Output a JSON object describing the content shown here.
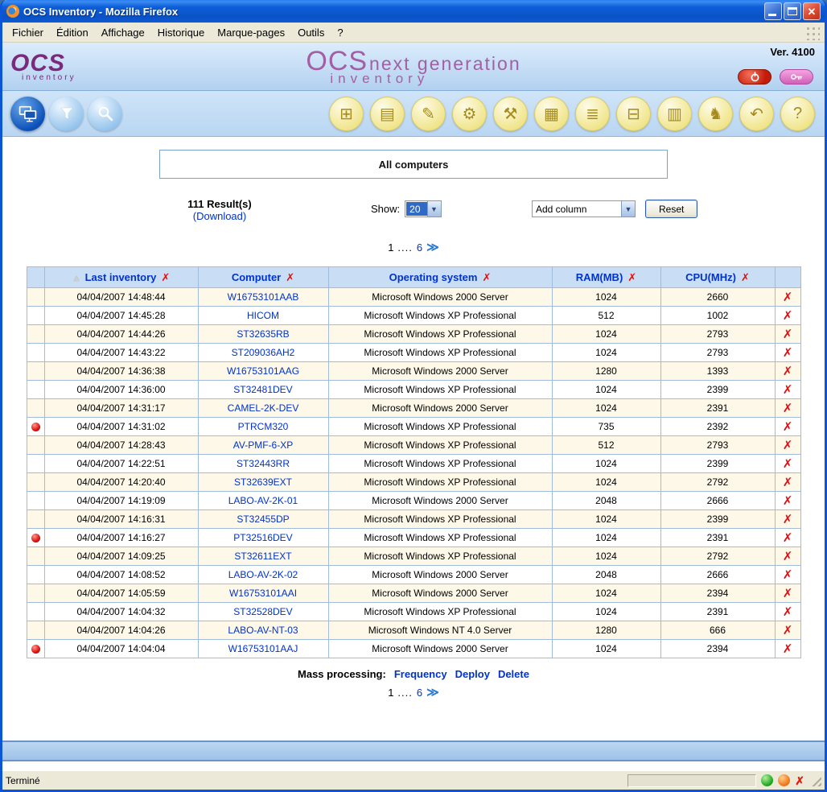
{
  "colors": {
    "accent_blue": "#0033cc",
    "alert_red": "#cc0000",
    "brand_purple": "#9b3d9b",
    "row_alt": "#fdf8e7"
  },
  "window": {
    "title": "OCS Inventory - Mozilla Firefox",
    "menu_items": [
      "Fichier",
      "Édition",
      "Affichage",
      "Historique",
      "Marque-pages",
      "Outils",
      "?"
    ]
  },
  "header": {
    "logo_main": "OCS",
    "logo_sub": "inventory",
    "brand_line1_big": "OCS",
    "brand_line1_rest": "next generation",
    "brand_line2": "inventory",
    "version": "Ver. 4100"
  },
  "toolbar": {
    "left_icons": [
      "all-computers-icon",
      "filter-icon",
      "search-icon"
    ],
    "right_icons": [
      {
        "name": "gift-icon",
        "glyph": "⊞"
      },
      {
        "name": "firewall-icon",
        "glyph": "▤"
      },
      {
        "name": "tag-edit-icon",
        "glyph": "✎"
      },
      {
        "name": "settings-icon",
        "glyph": "⚙"
      },
      {
        "name": "wrench-icon",
        "glyph": "⚒"
      },
      {
        "name": "packages-icon",
        "glyph": "▦"
      },
      {
        "name": "documents-icon",
        "glyph": "≣"
      },
      {
        "name": "duplicates-icon",
        "glyph": "⊟"
      },
      {
        "name": "report-icon",
        "glyph": "▥"
      },
      {
        "name": "agent-icon",
        "glyph": "♞"
      },
      {
        "name": "restore-icon",
        "glyph": "↶"
      },
      {
        "name": "help-icon",
        "glyph": "?"
      }
    ]
  },
  "content": {
    "page_title": "All computers",
    "results_count": "111 Result(s)",
    "download_label": "(Download)",
    "show_label": "Show:",
    "show_value": "20",
    "add_column_value": "Add column",
    "reset_label": "Reset",
    "pagination": {
      "current": "1",
      "dots": "....",
      "last_page": "6"
    },
    "mass_processing_label": "Mass processing:",
    "mass_actions": [
      "Frequency",
      "Deploy",
      "Delete"
    ]
  },
  "table": {
    "columns": [
      "Last inventory",
      "Computer",
      "Operating system",
      "RAM(MB)",
      "CPU(MHz)"
    ],
    "rows": [
      {
        "alert": false,
        "last_inventory": "04/04/2007 14:48:44",
        "computer": "W16753101AAB",
        "os": "Microsoft Windows 2000 Server",
        "ram": "1024",
        "cpu": "2660"
      },
      {
        "alert": false,
        "last_inventory": "04/04/2007 14:45:28",
        "computer": "HICOM",
        "os": "Microsoft Windows XP Professional",
        "ram": "512",
        "cpu": "1002"
      },
      {
        "alert": false,
        "last_inventory": "04/04/2007 14:44:26",
        "computer": "ST32635RB",
        "os": "Microsoft Windows XP Professional",
        "ram": "1024",
        "cpu": "2793"
      },
      {
        "alert": false,
        "last_inventory": "04/04/2007 14:43:22",
        "computer": "ST209036AH2",
        "os": "Microsoft Windows XP Professional",
        "ram": "1024",
        "cpu": "2793"
      },
      {
        "alert": false,
        "last_inventory": "04/04/2007 14:36:38",
        "computer": "W16753101AAG",
        "os": "Microsoft Windows 2000 Server",
        "ram": "1280",
        "cpu": "1393"
      },
      {
        "alert": false,
        "last_inventory": "04/04/2007 14:36:00",
        "computer": "ST32481DEV",
        "os": "Microsoft Windows XP Professional",
        "ram": "1024",
        "cpu": "2399"
      },
      {
        "alert": false,
        "last_inventory": "04/04/2007 14:31:17",
        "computer": "CAMEL-2K-DEV",
        "os": "Microsoft Windows 2000 Server",
        "ram": "1024",
        "cpu": "2391"
      },
      {
        "alert": true,
        "last_inventory": "04/04/2007 14:31:02",
        "computer": "PTRCM320",
        "os": "Microsoft Windows XP Professional",
        "ram": "735",
        "cpu": "2392"
      },
      {
        "alert": false,
        "last_inventory": "04/04/2007 14:28:43",
        "computer": "AV-PMF-6-XP",
        "os": "Microsoft Windows XP Professional",
        "ram": "512",
        "cpu": "2793"
      },
      {
        "alert": false,
        "last_inventory": "04/04/2007 14:22:51",
        "computer": "ST32443RR",
        "os": "Microsoft Windows XP Professional",
        "ram": "1024",
        "cpu": "2399"
      },
      {
        "alert": false,
        "last_inventory": "04/04/2007 14:20:40",
        "computer": "ST32639EXT",
        "os": "Microsoft Windows XP Professional",
        "ram": "1024",
        "cpu": "2792"
      },
      {
        "alert": false,
        "last_inventory": "04/04/2007 14:19:09",
        "computer": "LABO-AV-2K-01",
        "os": "Microsoft Windows 2000 Server",
        "ram": "2048",
        "cpu": "2666"
      },
      {
        "alert": false,
        "last_inventory": "04/04/2007 14:16:31",
        "computer": "ST32455DP",
        "os": "Microsoft Windows XP Professional",
        "ram": "1024",
        "cpu": "2399"
      },
      {
        "alert": true,
        "last_inventory": "04/04/2007 14:16:27",
        "computer": "PT32516DEV",
        "os": "Microsoft Windows XP Professional",
        "ram": "1024",
        "cpu": "2391"
      },
      {
        "alert": false,
        "last_inventory": "04/04/2007 14:09:25",
        "computer": "ST32611EXT",
        "os": "Microsoft Windows XP Professional",
        "ram": "1024",
        "cpu": "2792"
      },
      {
        "alert": false,
        "last_inventory": "04/04/2007 14:08:52",
        "computer": "LABO-AV-2K-02",
        "os": "Microsoft Windows 2000 Server",
        "ram": "2048",
        "cpu": "2666"
      },
      {
        "alert": false,
        "last_inventory": "04/04/2007 14:05:59",
        "computer": "W16753101AAI",
        "os": "Microsoft Windows 2000 Server",
        "ram": "1024",
        "cpu": "2394"
      },
      {
        "alert": false,
        "last_inventory": "04/04/2007 14:04:32",
        "computer": "ST32528DEV",
        "os": "Microsoft Windows XP Professional",
        "ram": "1024",
        "cpu": "2391"
      },
      {
        "alert": false,
        "last_inventory": "04/04/2007 14:04:26",
        "computer": "LABO-AV-NT-03",
        "os": "Microsoft Windows NT 4.0 Server",
        "ram": "1280",
        "cpu": "666"
      },
      {
        "alert": true,
        "last_inventory": "04/04/2007 14:04:04",
        "computer": "W16753101AAJ",
        "os": "Microsoft Windows 2000 Server",
        "ram": "1024",
        "cpu": "2394"
      }
    ]
  },
  "statusbar": {
    "text": "Terminé"
  }
}
